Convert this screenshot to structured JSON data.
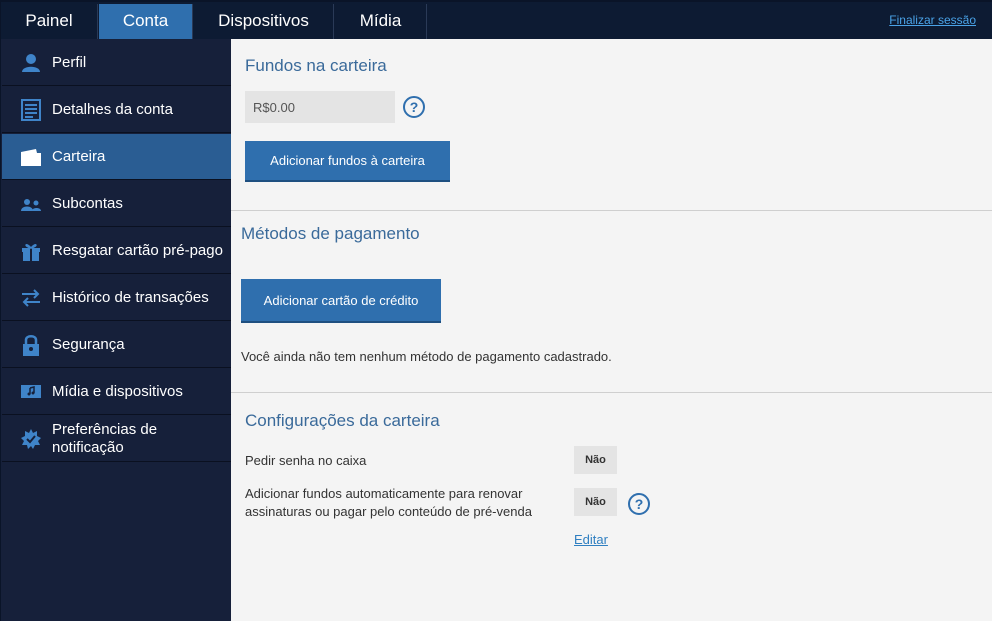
{
  "nav": {
    "tabs": [
      {
        "label": "Painel"
      },
      {
        "label": "Conta"
      },
      {
        "label": "Dispositivos"
      },
      {
        "label": "Mídia"
      }
    ],
    "logout": "Finalizar sessão"
  },
  "sidebar": {
    "items": [
      {
        "label": "Perfil",
        "icon": "person-icon"
      },
      {
        "label": "Detalhes da conta",
        "icon": "document-icon"
      },
      {
        "label": "Carteira",
        "icon": "wallet-icon"
      },
      {
        "label": "Subcontas",
        "icon": "users-icon"
      },
      {
        "label": "Resgatar cartão pré-pago",
        "icon": "gift-icon"
      },
      {
        "label": "Histórico de transações",
        "icon": "arrows-icon"
      },
      {
        "label": "Segurança",
        "icon": "lock-icon"
      },
      {
        "label": "Mídia e dispositivos",
        "icon": "media-icon"
      },
      {
        "label": "Preferências de\nnotificação",
        "icon": "badge-icon"
      }
    ]
  },
  "funds": {
    "title": "Fundos na carteira",
    "value": "R$0.00",
    "add_button": "Adicionar fundos à carteira"
  },
  "payment": {
    "title": "Métodos de pagamento",
    "add_button": "Adicionar cartão de crédito",
    "empty_text": "Você ainda não tem nenhum método de pagamento cadastrado."
  },
  "settings": {
    "title": "Configurações da carteira",
    "password_label": "Pedir senha no caixa",
    "password_value": "Não",
    "autofund_label": "Adicionar fundos automaticamente para renovar\nassinaturas ou pagar pelo conteúdo de pré-venda",
    "autofund_value": "Não",
    "edit_link": "Editar"
  },
  "colors": {
    "nav_bg": "#0d1b33",
    "accent": "#2f6fae",
    "sidebar_bg": "#16203a",
    "heading": "#3a6a9a"
  }
}
